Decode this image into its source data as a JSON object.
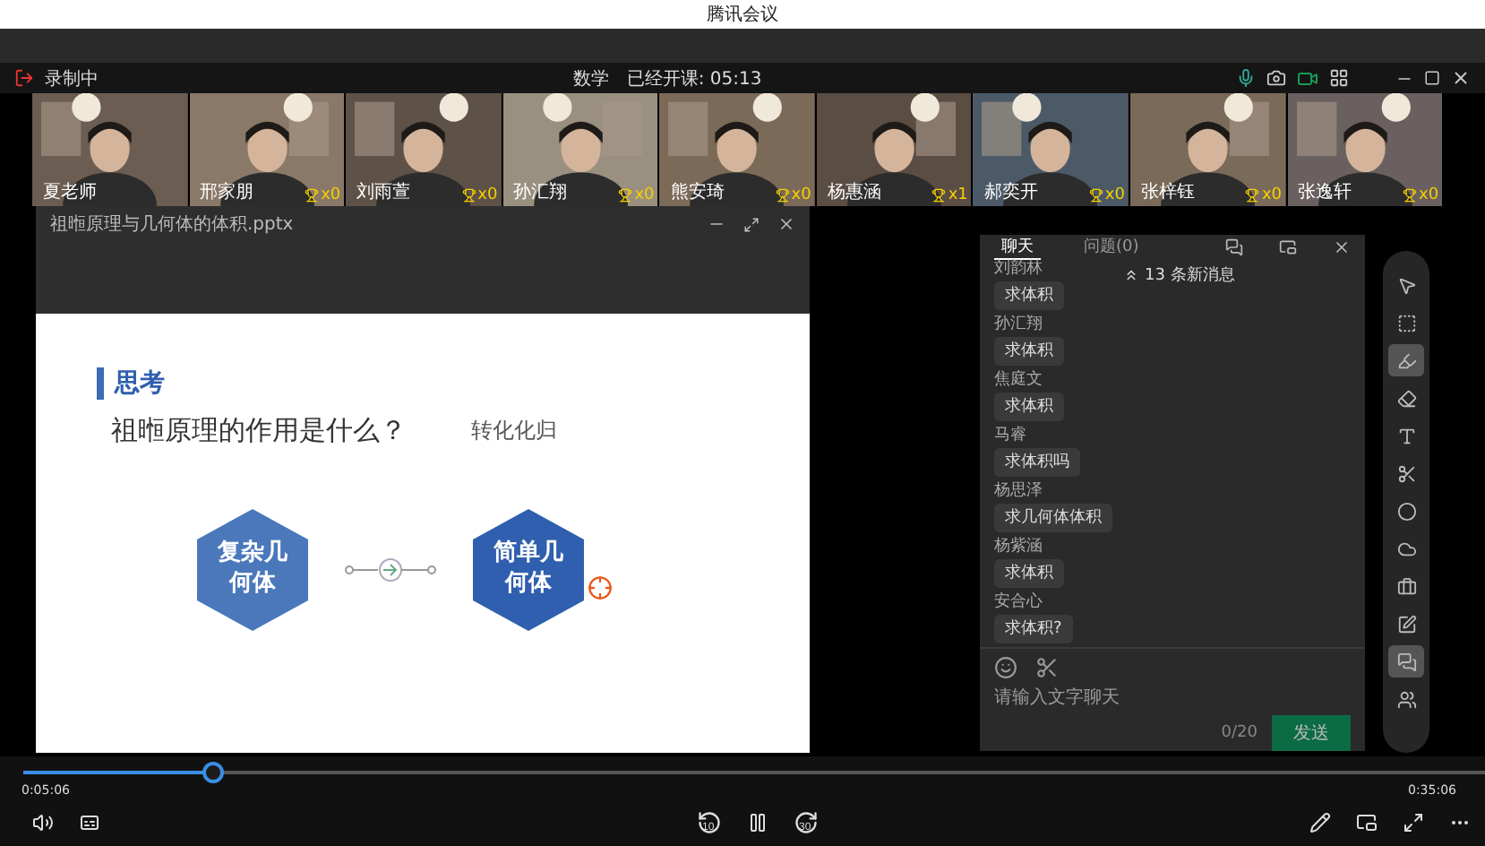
{
  "app_title": "腾讯会议",
  "class_bar": {
    "status": "录制中",
    "subject": "数学",
    "elapsed": "已经开课: 05:13"
  },
  "participants": [
    {
      "name": "夏老师"
    },
    {
      "name": "邢家朋",
      "trophies": "x0"
    },
    {
      "name": "刘雨萱",
      "trophies": "x0"
    },
    {
      "name": "孙汇翔",
      "trophies": "x0"
    },
    {
      "name": "熊安琦",
      "trophies": "x0"
    },
    {
      "name": "杨惠涵",
      "trophies": "x1"
    },
    {
      "name": "郝奕开",
      "trophies": "x0"
    },
    {
      "name": "张梓钰",
      "trophies": "x0"
    },
    {
      "name": "张逸轩",
      "trophies": "x0"
    }
  ],
  "slide_window": {
    "title": "祖暅原理与几何体的体积.pptx",
    "heading": "思考",
    "question": "祖暅原理的作用是什么？",
    "note": "转化化归",
    "from": "复杂几何体",
    "to": "简单几何体"
  },
  "chat": {
    "tabs": [
      {
        "label": "聊天",
        "selected": true
      },
      {
        "label": "问题(0)",
        "selected": false
      }
    ],
    "new_messages": "13 条新消息",
    "messages": [
      {
        "sender": "刘韵林",
        "text": "求体积"
      },
      {
        "sender": "孙汇翔",
        "text": "求体积"
      },
      {
        "sender": "焦庭文",
        "text": "求体积"
      },
      {
        "sender": "马睿",
        "text": "求体积吗"
      },
      {
        "sender": "杨思泽",
        "text": "求几何体体积"
      },
      {
        "sender": "杨紫涵",
        "text": "求体积"
      },
      {
        "sender": "安合心",
        "text": "求体积?"
      }
    ],
    "placeholder": "请输入文字聊天",
    "send": "发送",
    "counter": "0/20"
  },
  "tools": [
    {
      "kind": "pointer",
      "selected": false
    },
    {
      "kind": "select",
      "selected": false
    },
    {
      "kind": "highlighter",
      "selected": true
    },
    {
      "kind": "eraser",
      "selected": false
    },
    {
      "kind": "text",
      "selected": false
    },
    {
      "kind": "scissors",
      "selected": false
    },
    {
      "kind": "circle",
      "selected": false
    },
    {
      "kind": "cloud",
      "selected": false
    },
    {
      "kind": "toolbox",
      "selected": false
    },
    {
      "kind": "edit",
      "selected": false
    },
    {
      "kind": "chat",
      "selected": true
    },
    {
      "kind": "users",
      "selected": false
    }
  ],
  "player": {
    "current": "0:05:06",
    "total": "0:35:06",
    "level": 0.13,
    "skip_back": "10",
    "skip_forward": "30"
  }
}
